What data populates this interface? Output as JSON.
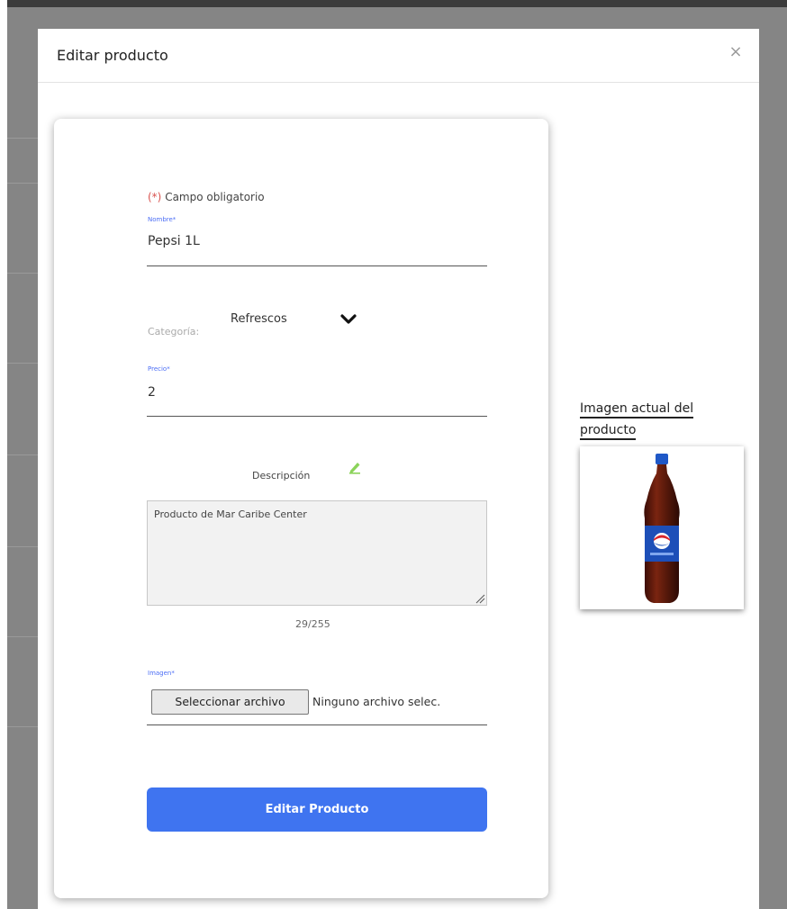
{
  "modal": {
    "title": "Editar producto",
    "close_label": "×"
  },
  "form": {
    "required_mark": "(*)",
    "required_text": " Campo obligatorio",
    "nombre": {
      "label": "Nombre*",
      "value": "Pepsi 1L"
    },
    "categoria": {
      "label": "Categoría:",
      "value": "Refrescos"
    },
    "precio": {
      "label": "Precio*",
      "value": "2"
    },
    "descripcion": {
      "label": "Descripción",
      "value": "Producto de Mar Caribe Center",
      "counter": "29/255"
    },
    "imagen": {
      "label": "Imagen*",
      "button_label": "Seleccionar archivo",
      "status": "Ninguno archivo selec."
    },
    "submit_label": "Editar Producto"
  },
  "preview": {
    "caption_line1": "Imagen actual del",
    "caption_line2": "producto"
  },
  "colors": {
    "accent": "#3f74f0",
    "label_blue": "#4c6ef5",
    "required_red": "#d9534f",
    "pencil_green": "#8bd35a"
  }
}
